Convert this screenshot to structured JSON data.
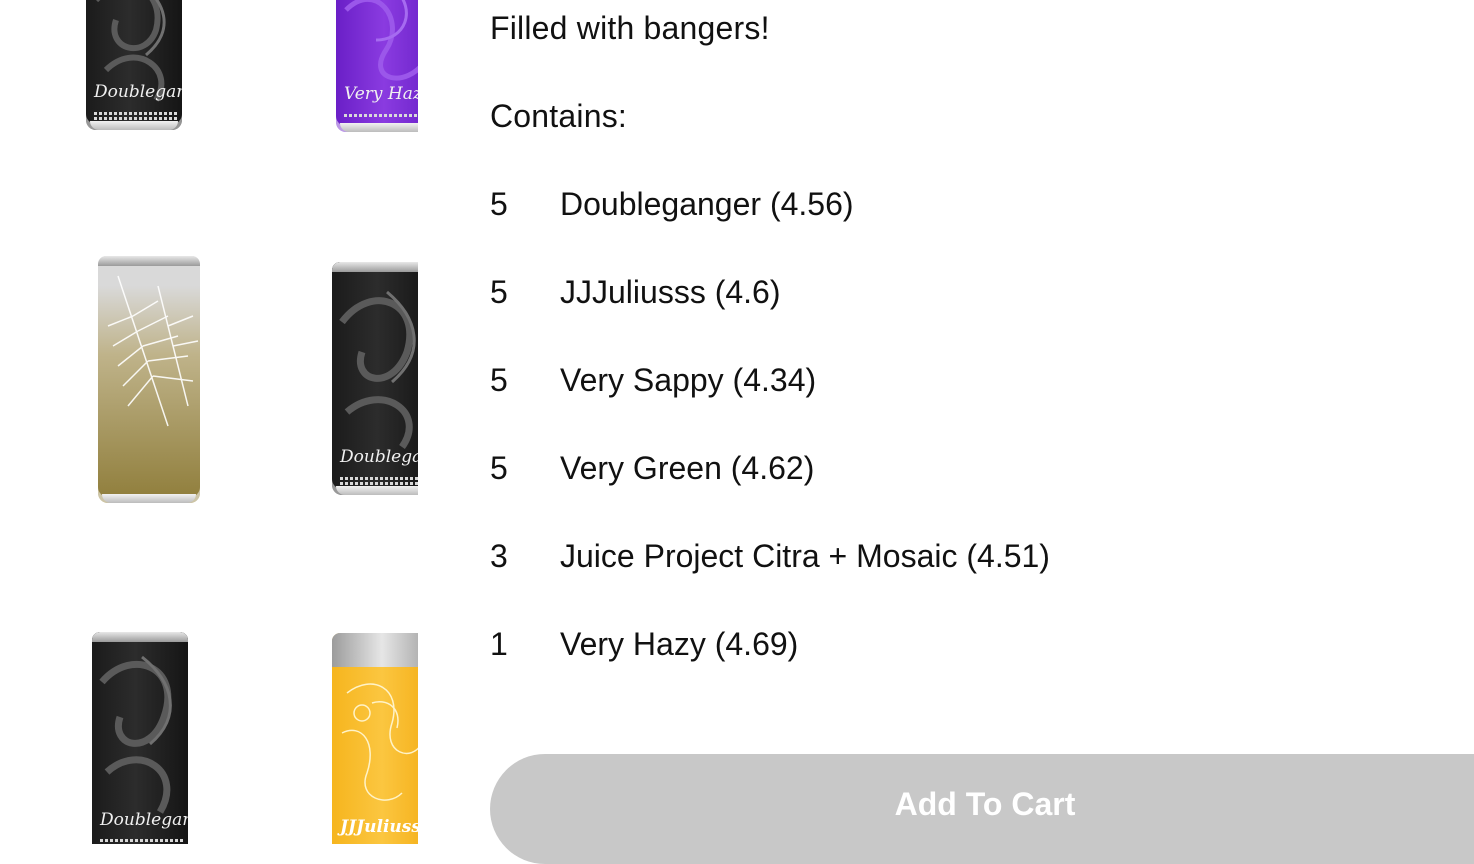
{
  "gallery": {
    "images": [
      {
        "name": "doubleganger-can",
        "script": "Doubleganger",
        "color": "#1b1b1b"
      },
      {
        "name": "very-hazy-can",
        "script": "Very Hazy",
        "color": "#7a2fd8"
      },
      {
        "name": "very-sappy-can",
        "script": "",
        "color": "#b3a360"
      },
      {
        "name": "doubleganger-can",
        "script": "Doubleganger",
        "color": "#1b1b1b"
      },
      {
        "name": "doubleganger-can",
        "script": "Doubleganger",
        "color": "#1b1b1b"
      },
      {
        "name": "jjjuliusss-can",
        "script": "JJJuliusss!",
        "color": "#f8bc2b"
      }
    ]
  },
  "product": {
    "description": "Filled with bangers!",
    "contains_label": "Contains:",
    "items": [
      {
        "qty": "5",
        "name": "Doubleganger (4.56)"
      },
      {
        "qty": "5",
        "name": "JJJuliusss (4.6)"
      },
      {
        "qty": "5",
        "name": "Very Sappy (4.34)"
      },
      {
        "qty": "5",
        "name": "Very Green (4.62)"
      },
      {
        "qty": "3",
        "name": "Juice Project Citra + Mosaic (4.51)"
      },
      {
        "qty": "1",
        "name": "Very Hazy (4.69)"
      }
    ],
    "add_to_cart_label": "Add To Cart",
    "button_color": "#c8c8c8"
  }
}
